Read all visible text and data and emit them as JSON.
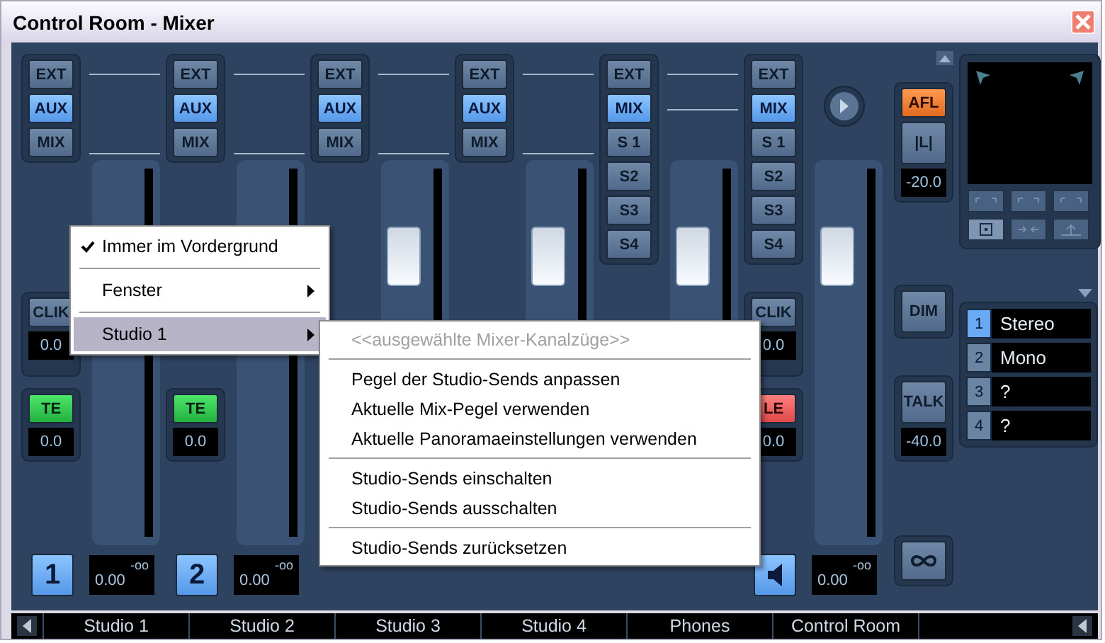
{
  "window": {
    "title": "Control Room - Mixer"
  },
  "strips": [
    {
      "buttons": [
        {
          "label": "EXT",
          "selected": false
        },
        {
          "label": "AUX",
          "selected": true
        },
        {
          "label": "MIX",
          "selected": false
        }
      ],
      "clik": {
        "label": "CLIK",
        "value": "0.0"
      },
      "te": {
        "kind": "green",
        "label": "TE",
        "value": "0.0"
      },
      "bottom": {
        "kind": "number",
        "label": "1",
        "selected": true
      },
      "readout": {
        "peak": "-oo",
        "value": "0.00"
      }
    },
    {
      "buttons": [
        {
          "label": "EXT",
          "selected": false
        },
        {
          "label": "AUX",
          "selected": true
        },
        {
          "label": "MIX",
          "selected": false
        }
      ],
      "te": {
        "kind": "green",
        "label": "TE",
        "value": "0.0"
      },
      "bottom": {
        "kind": "number",
        "label": "2",
        "selected": true
      },
      "readout": {
        "peak": "-oo",
        "value": "0.00"
      }
    },
    {
      "buttons": [
        {
          "label": "EXT",
          "selected": false
        },
        {
          "label": "AUX",
          "selected": true
        },
        {
          "label": "MIX",
          "selected": false
        }
      ],
      "level": 0.75
    },
    {
      "buttons": [
        {
          "label": "EXT",
          "selected": false
        },
        {
          "label": "AUX",
          "selected": true
        },
        {
          "label": "MIX",
          "selected": false
        }
      ],
      "level": 0.75
    },
    {
      "buttons": [
        {
          "label": "EXT",
          "selected": false
        },
        {
          "label": "MIX",
          "selected": true
        },
        {
          "label": "S 1",
          "selected": false
        },
        {
          "label": "S2",
          "selected": false
        },
        {
          "label": "S3",
          "selected": false
        },
        {
          "label": "S4",
          "selected": false
        }
      ],
      "level": 0.75
    },
    {
      "buttons": [
        {
          "label": "EXT",
          "selected": false
        },
        {
          "label": "MIX",
          "selected": true
        },
        {
          "label": "S 1",
          "selected": false
        },
        {
          "label": "S2",
          "selected": false
        },
        {
          "label": "S3",
          "selected": false
        },
        {
          "label": "S4",
          "selected": false
        }
      ],
      "knob": true,
      "level": 0.75,
      "clik": {
        "label": "CLIK",
        "value": "0.0"
      },
      "te": {
        "kind": "red",
        "label": "LE",
        "value": "0.0"
      },
      "bottom": {
        "kind": "speaker",
        "selected": true
      },
      "readout": {
        "peak": "-oo",
        "value": "0.00"
      }
    }
  ],
  "monitor": {
    "afl": {
      "label": "AFL",
      "on": true
    },
    "mono": {
      "label": "|L|"
    },
    "afl_value": "-20.0",
    "dim": {
      "label": "DIM"
    },
    "talk": {
      "label": "TALK"
    },
    "talk_value": "-40.0"
  },
  "outputs": [
    {
      "number": "1",
      "name": "Stereo",
      "selected": true
    },
    {
      "number": "2",
      "name": "Mono",
      "selected": false
    },
    {
      "number": "3",
      "name": "?",
      "selected": false
    },
    {
      "number": "4",
      "name": "?",
      "selected": false
    }
  ],
  "channel_names": [
    "Studio 1",
    "Studio 2",
    "Studio 3",
    "Studio 4",
    "Phones",
    "Control Room"
  ],
  "context_menu": {
    "groups": [
      [
        {
          "label": "Immer im Vordergrund",
          "checked": true,
          "submenu": false,
          "selected": false
        }
      ],
      [
        {
          "label": "Fenster",
          "checked": false,
          "submenu": true,
          "selected": false
        }
      ],
      [
        {
          "label": "Studio 1",
          "checked": false,
          "submenu": true,
          "selected": true
        }
      ]
    ]
  },
  "submenu": {
    "groups": [
      [
        {
          "label": "<<ausgewählte Mixer-Kanalzüge>>",
          "disabled": true
        }
      ],
      [
        {
          "label": "Pegel der Studio-Sends anpassen",
          "disabled": false
        },
        {
          "label": "Aktuelle Mix-Pegel verwenden",
          "disabled": false
        },
        {
          "label": "Aktuelle Panoramaeinstellungen verwenden",
          "disabled": false
        }
      ],
      [
        {
          "label": "Studio-Sends einschalten",
          "disabled": false
        },
        {
          "label": "Studio-Sends ausschalten",
          "disabled": false
        }
      ],
      [
        {
          "label": "Studio-Sends zurücksetzen",
          "disabled": false
        }
      ]
    ]
  }
}
